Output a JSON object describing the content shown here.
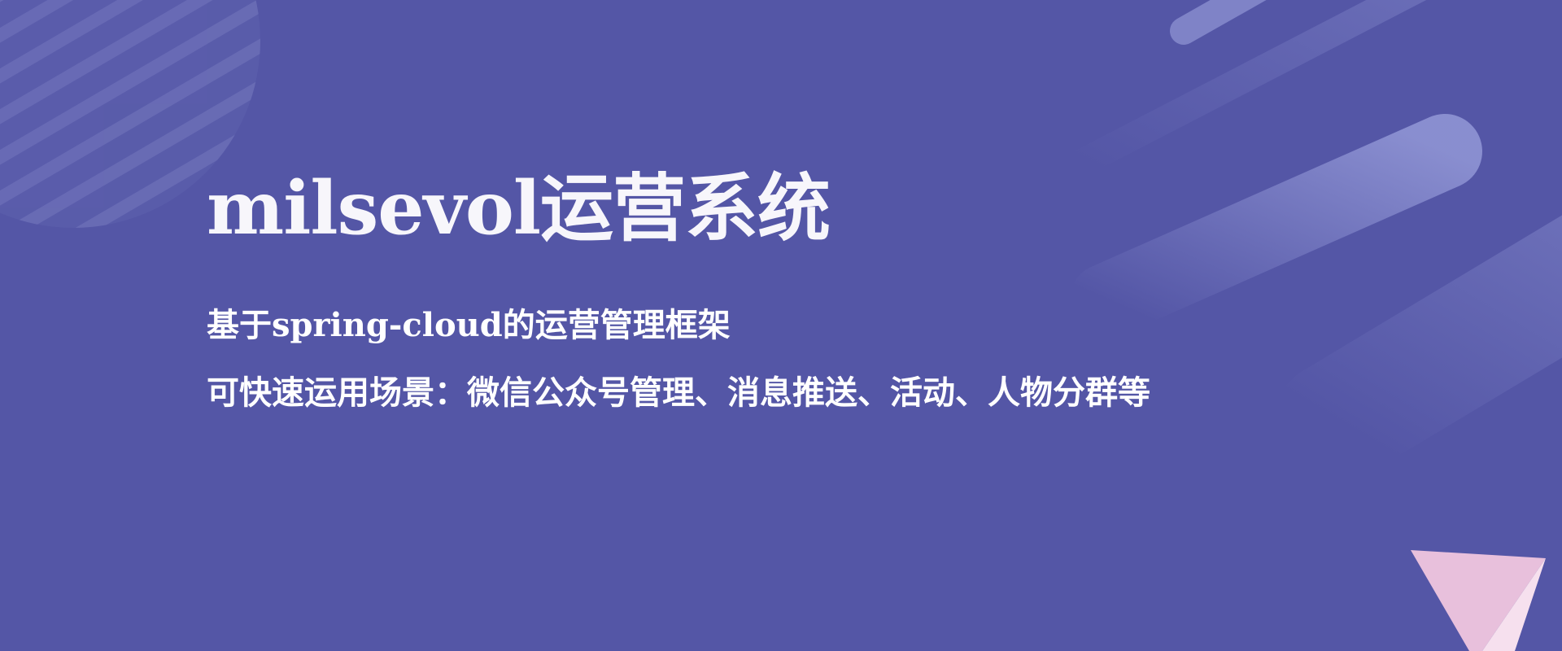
{
  "banner": {
    "title": "milsevol运营系统",
    "subtitle": "基于spring-cloud的运营管理框架",
    "description": "可快速运用场景：微信公众号管理、消息推送、活动、人物分群等"
  },
  "colors": {
    "background": "#5456a6",
    "stripe": "#7a7dc6",
    "text": "#ffffff",
    "triangle_pink": "#e8c0dc",
    "triangle_light": "#f6e0ee"
  }
}
